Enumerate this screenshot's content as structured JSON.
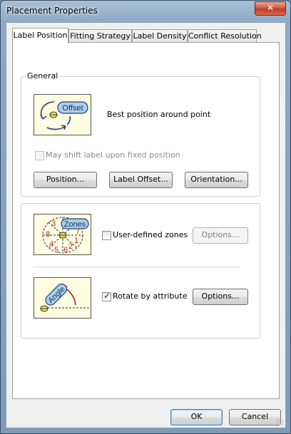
{
  "window": {
    "title": "Placement Properties",
    "close_glyph": "✕"
  },
  "tabs": [
    {
      "label": "Label Position"
    },
    {
      "label": "Fitting Strategy"
    },
    {
      "label": "Label Density"
    },
    {
      "label": "Conflict Resolution"
    }
  ],
  "general": {
    "group_label": "General",
    "image_text": "Offset",
    "description": "Best position around point",
    "shift_checkbox": {
      "label": "May shift label upon fixed position",
      "checked": false,
      "enabled": false
    },
    "buttons": {
      "position": "Position...",
      "label_offset": "Label Offset...",
      "orientation": "Orientation..."
    }
  },
  "zones": {
    "image_text": "Zones",
    "zone_numbers": [
      "3",
      "7",
      "8",
      "1",
      "4",
      "5",
      "6",
      "2"
    ],
    "checkbox": {
      "label": "User-defined zones",
      "checked": false
    },
    "options_label": "Options..."
  },
  "rotate": {
    "image_text": "Angle",
    "checkbox": {
      "label": "Rotate by attribute",
      "checked": true
    },
    "options_label": "Options..."
  },
  "footer": {
    "ok_label": "OK",
    "cancel_label": "Cancel"
  }
}
